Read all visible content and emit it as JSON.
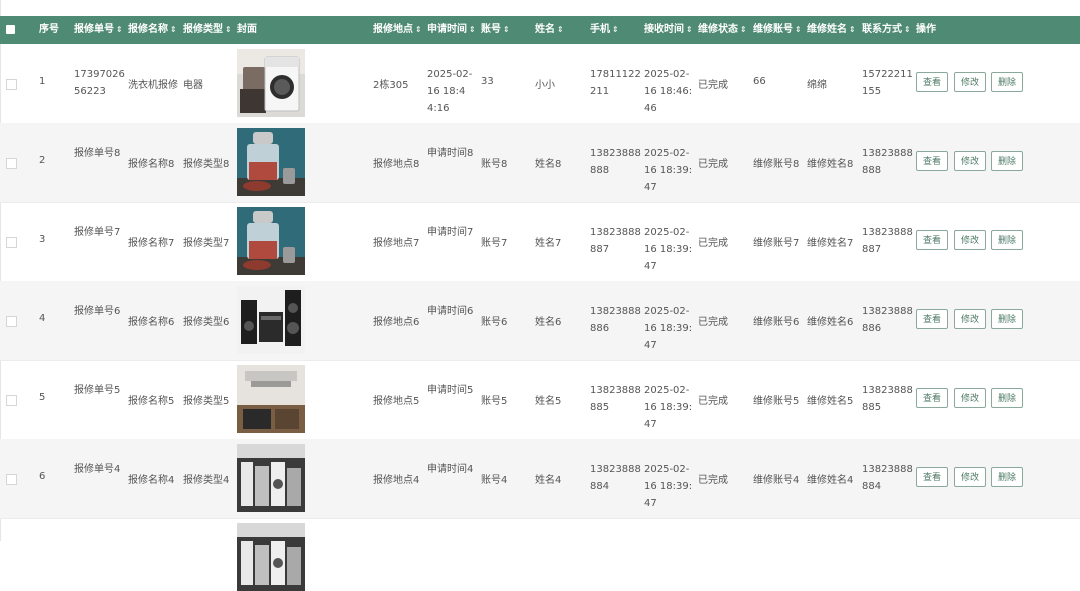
{
  "table": {
    "columns": [
      {
        "key": "seq",
        "label": "序号",
        "sortable": false
      },
      {
        "key": "order_no",
        "label": "报修单号",
        "sortable": true
      },
      {
        "key": "repair_name",
        "label": "报修名称",
        "sortable": true
      },
      {
        "key": "repair_type",
        "label": "报修类型",
        "sortable": true
      },
      {
        "key": "cover",
        "label": "封面",
        "sortable": false
      },
      {
        "key": "location",
        "label": "报修地点",
        "sortable": true
      },
      {
        "key": "apply_time",
        "label": "申请时间",
        "sortable": true
      },
      {
        "key": "account",
        "label": "账号",
        "sortable": true
      },
      {
        "key": "name",
        "label": "姓名",
        "sortable": true
      },
      {
        "key": "phone",
        "label": "手机",
        "sortable": true
      },
      {
        "key": "receive_time",
        "label": "接收时间",
        "sortable": true
      },
      {
        "key": "status",
        "label": "维修状态",
        "sortable": true
      },
      {
        "key": "repair_account",
        "label": "维修账号",
        "sortable": true
      },
      {
        "key": "repair_name2",
        "label": "维修姓名",
        "sortable": true
      },
      {
        "key": "contact",
        "label": "联系方式",
        "sortable": true
      },
      {
        "key": "actions",
        "label": "操作",
        "sortable": false
      }
    ],
    "sort_icon": "⇕",
    "actions": {
      "view": "查看",
      "edit": "修改",
      "delete": "删除"
    },
    "rows": [
      {
        "seq": "1",
        "order_no": "1739702656223",
        "repair_name": "洗衣机报修",
        "repair_type": "电器",
        "cover": "washing-machine",
        "location": "2栋305",
        "apply_time": "2025-02-16 18:44:16",
        "account": "33",
        "name": "小小",
        "phone": "17811122211",
        "receive_time": "2025-02-16 18:46:46",
        "status": "已完成",
        "repair_account": "66",
        "repair_name2": "绵绵",
        "contact": "15722211155"
      },
      {
        "seq": "2",
        "order_no": "报修单号8",
        "repair_name": "报修名称8",
        "repair_type": "报修类型8",
        "cover": "food-chopper",
        "location": "报修地点8",
        "apply_time": "申请时间8",
        "account": "账号8",
        "name": "姓名8",
        "phone": "13823888888",
        "receive_time": "2025-02-16 18:39:47",
        "status": "已完成",
        "repair_account": "维修账号8",
        "repair_name2": "维修姓名8",
        "contact": "13823888888"
      },
      {
        "seq": "3",
        "order_no": "报修单号7",
        "repair_name": "报修名称7",
        "repair_type": "报修类型7",
        "cover": "food-chopper",
        "location": "报修地点7",
        "apply_time": "申请时间7",
        "account": "账号7",
        "name": "姓名7",
        "phone": "13823888887",
        "receive_time": "2025-02-16 18:39:47",
        "status": "已完成",
        "repair_account": "维修账号7",
        "repair_name2": "维修姓名7",
        "contact": "13823888887"
      },
      {
        "seq": "4",
        "order_no": "报修单号6",
        "repair_name": "报修名称6",
        "repair_type": "报修类型6",
        "cover": "audio-system",
        "location": "报修地点6",
        "apply_time": "申请时间6",
        "account": "账号6",
        "name": "姓名6",
        "phone": "13823888886",
        "receive_time": "2025-02-16 18:39:47",
        "status": "已完成",
        "repair_account": "维修账号6",
        "repair_name2": "维修姓名6",
        "contact": "13823888886"
      },
      {
        "seq": "5",
        "order_no": "报修单号5",
        "repair_name": "报修名称5",
        "repair_type": "报修类型5",
        "cover": "kitchen",
        "location": "报修地点5",
        "apply_time": "申请时间5",
        "account": "账号5",
        "name": "姓名5",
        "phone": "13823888885",
        "receive_time": "2025-02-16 18:39:47",
        "status": "已完成",
        "repair_account": "维修账号5",
        "repair_name2": "维修姓名5",
        "contact": "13823888885"
      },
      {
        "seq": "6",
        "order_no": "报修单号4",
        "repair_name": "报修名称4",
        "repair_type": "报修类型4",
        "cover": "appliance-store",
        "location": "报修地点4",
        "apply_time": "申请时间4",
        "account": "账号4",
        "name": "姓名4",
        "phone": "13823888884",
        "receive_time": "2025-02-16 18:39:47",
        "status": "已完成",
        "repair_account": "维修账号4",
        "repair_name2": "维修姓名4",
        "contact": "13823888884"
      }
    ],
    "partial_row_cover": "appliance-store"
  },
  "colors": {
    "header_bg": "#4e8a74",
    "header_text": "#ffffff",
    "button_border": "#8aa99b",
    "button_text": "#4e7a66",
    "row_alt": "#f5f5f5"
  }
}
